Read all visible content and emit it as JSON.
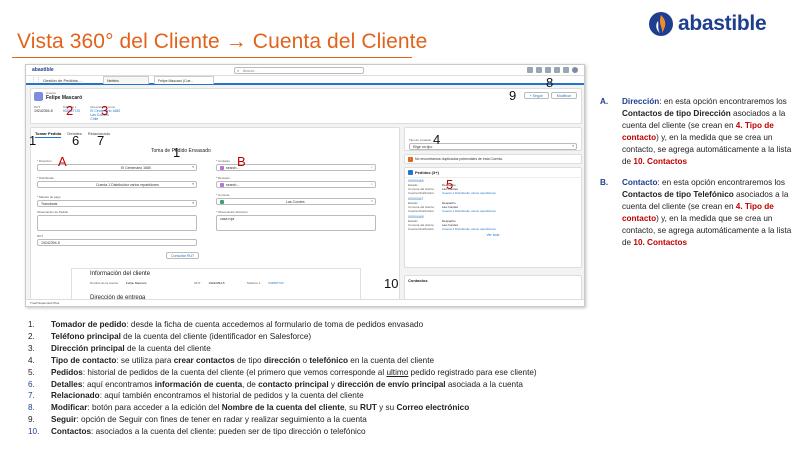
{
  "slide": {
    "title": "Vista 360° del Cliente → Cuenta del Cliente",
    "logo_text": "abastible"
  },
  "colors": {
    "accent": "#e2621b",
    "brand_blue": "#1e3f8f",
    "annotation_red": "#c00000",
    "sf_blue": "#2574c9"
  },
  "shot": {
    "brand": "abastible",
    "search_placeholder": "Buscar...",
    "app_name": "Gestión de Pedidos ...",
    "tab1": "Nefeles",
    "tab2": "Felipe Mascaró (Cue...",
    "record_type": "Cuenta",
    "record_name": "Felipe Mascaró",
    "rut_label": "RUT",
    "rut_value": "19242394-5",
    "telefono_label": "Teléfono 1",
    "telefono_value": "934587720",
    "direccion_label": "Dirección de envío",
    "direccion_lines": [
      "El Centenario 1680",
      "Las Condes",
      "Chile"
    ],
    "btn_seguir": "+ Seguir",
    "btn_modificar": "Modificar",
    "subtabs": [
      "Tomar Pedido",
      "Detalles",
      "Relacionado"
    ],
    "form_title": "Toma de Pedido Envasado",
    "direccion_field_label": "* Dirección",
    "direccion_field_value": "El Centenario 1680",
    "contacto_label": "* Contacto",
    "contacto_value": "search...",
    "distribuidor_label": "* Distribuidor",
    "distribuidor_value": "Cuenta 1 Distribuidor varios repartidores",
    "receptor_label": "* Receptor",
    "receptor_value": "search...",
    "comuna_label": "* Comuna",
    "comuna_value": "Las Condes",
    "metodo_pago_label": "* Método de pago",
    "metodo_pago_value": "Transbank",
    "obs_pedido_label": "Observación de Pedido",
    "obs_direccion_label": "* Observación dirección",
    "obs_direccion_value": "casa roja",
    "rut_field_label": "RUT",
    "rut_field_value": "19242394-5",
    "consultar_btn": "Consultar RUT",
    "info_title": "Información del cliente",
    "info_nombre_label": "Nombre de la cuenta",
    "info_nombre_value": "Felipe Mascaró",
    "info_rut_label": "RUT",
    "info_rut_value": "19242394-5",
    "info_tel_label": "Teléfono 1",
    "info_tel_value": "934587720",
    "info_sub": "Dirección de entrega",
    "tipo_contacto_label": "Tipo de contacto",
    "tipo_contacto_value": "Elige un tipo",
    "warn_text": "No encontramos duplicados potenciales de esta Cuenta.",
    "pedidos_title": "Pedidos (3+)",
    "pedidos": [
      {
        "num": "00004446",
        "estado": "Despacho",
        "comuna": "Las Condes",
        "dist": "Cuenta 1 Distribuidor varios repartidores"
      },
      {
        "num": "00004447",
        "estado": "Despacho",
        "comuna": "Las Condes",
        "dist": "Cuenta 1 Distribuidor varios repartidores"
      },
      {
        "num": "00004448",
        "estado": "Despacho",
        "comuna": "Las Condes",
        "dist": "Cuenta 1 Distribuidor varios repartidores"
      }
    ],
    "ped_keys": {
      "estado": "Estado:",
      "comuna": "Comuna del cliente:",
      "dist": "Cuenta Distribuidor:"
    },
    "ver_todo": "Ver todo",
    "contactos_title": "Contactos",
    "footer": "Truell Supervisor Plus"
  },
  "annotations": {
    "n1a": "1",
    "n2": "2",
    "n3": "3",
    "n1b": "1",
    "n6": "6",
    "n7": "7",
    "n1c": "1",
    "n4": "4",
    "n5": "5",
    "n8": "8",
    "n9": "9",
    "n10": "10",
    "lA": "A",
    "lB": "B"
  },
  "notes": [
    {
      "letter": "A.",
      "parts": [
        {
          "t": "Dirección",
          "s": "blue"
        },
        {
          "t": ": en esta opción encontraremos los "
        },
        {
          "t": "Contactos de tipo Dirección",
          "s": "bold"
        },
        {
          "t": " asociados a la cuenta del cliente (se crean en "
        },
        {
          "t": "4. Tipo de contacto",
          "s": "red"
        },
        {
          "t": ") y, en la medida que se crea un contacto, se agrega automáticamente a la lista de "
        },
        {
          "t": "10. Contactos",
          "s": "red"
        }
      ]
    },
    {
      "letter": "B.",
      "parts": [
        {
          "t": "Contacto",
          "s": "blue"
        },
        {
          "t": ": en esta opción encontraremos los "
        },
        {
          "t": "Contactos de tipo Telefónico",
          "s": "bold"
        },
        {
          "t": " asociados a la cuenta del cliente (se crean en "
        },
        {
          "t": "4. Tipo de contacto",
          "s": "red"
        },
        {
          "t": ") y, en la medida que se crea un contacto, se agrega automáticamente a la lista de "
        },
        {
          "t": "10. Contactos",
          "s": "red"
        }
      ]
    }
  ],
  "list": [
    {
      "n": "1.",
      "blue": false,
      "parts": [
        {
          "t": "Tomador de pedido",
          "s": "bold"
        },
        {
          "t": ": desde la ficha de cuenta accedemos al formulario de toma de pedidos envasado"
        }
      ]
    },
    {
      "n": "2.",
      "blue": false,
      "parts": [
        {
          "t": "Teléfono principal",
          "s": "bold"
        },
        {
          "t": " de la cuenta del cliente (identificador en Salesforce)"
        }
      ]
    },
    {
      "n": "3.",
      "blue": false,
      "parts": [
        {
          "t": "Dirección principal",
          "s": "bold"
        },
        {
          "t": " de la cuenta del cliente"
        }
      ]
    },
    {
      "n": "4.",
      "blue": false,
      "parts": [
        {
          "t": "Tipo de contacto",
          "s": "bold"
        },
        {
          "t": ": se utiliza para "
        },
        {
          "t": "crear contactos",
          "s": "bold"
        },
        {
          "t": " de tipo "
        },
        {
          "t": "dirección",
          "s": "bold"
        },
        {
          "t": " o "
        },
        {
          "t": "telefónico",
          "s": "bold"
        },
        {
          "t": " en la cuenta del cliente"
        }
      ]
    },
    {
      "n": "5.",
      "blue": false,
      "parts": [
        {
          "t": "Pedidos",
          "s": "bold"
        },
        {
          "t": ": historial de pedidos de la cuenta del cliente (el primero que vemos corresponde al "
        },
        {
          "t": "ultimo",
          "s": "u"
        },
        {
          "t": " pedido registrado para ese cliente)"
        }
      ]
    },
    {
      "n": "6.",
      "blue": true,
      "parts": [
        {
          "t": "Detalles",
          "s": "bold"
        },
        {
          "t": ": aquí encontramos "
        },
        {
          "t": "información de cuenta",
          "s": "bold"
        },
        {
          "t": ", de "
        },
        {
          "t": "contacto principal",
          "s": "bold"
        },
        {
          "t": " y "
        },
        {
          "t": "dirección de envío principal",
          "s": "bold"
        },
        {
          "t": " asociada a la cuenta"
        }
      ]
    },
    {
      "n": "7.",
      "blue": true,
      "parts": [
        {
          "t": "Relacionado",
          "s": "bold"
        },
        {
          "t": ": aquí también encontramos el historial de pedidos y la cuenta del cliente"
        }
      ]
    },
    {
      "n": "8.",
      "blue": true,
      "parts": [
        {
          "t": "Modificar",
          "s": "bold"
        },
        {
          "t": ": botón para acceder a la edición del "
        },
        {
          "t": "Nombre de la cuenta del cliente",
          "s": "bold"
        },
        {
          "t": ", su "
        },
        {
          "t": "RUT",
          "s": "bold"
        },
        {
          "t": " y su "
        },
        {
          "t": "Correo electrónico",
          "s": "bold"
        }
      ]
    },
    {
      "n": "9.",
      "blue": false,
      "parts": [
        {
          "t": "Seguir",
          "s": "bold"
        },
        {
          "t": ": opción de Seguir con fines de tener en radar y realizar seguimiento a la cuenta"
        }
      ]
    },
    {
      "n": "10.",
      "blue": true,
      "parts": [
        {
          "t": "Contactos",
          "s": "bold"
        },
        {
          "t": ": asociados a la cuenta del cliente: pueden ser de tipo dirección o telefónico"
        }
      ]
    }
  ]
}
